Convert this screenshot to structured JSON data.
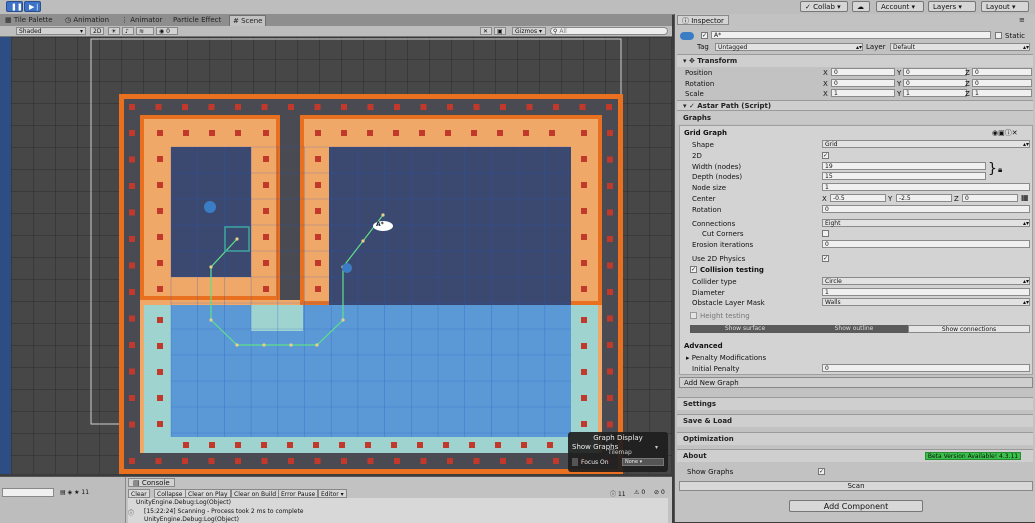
{
  "toolbar": {
    "collab": "Collab",
    "account": "Account",
    "layers": "Layers",
    "layout": "Layout"
  },
  "tabs": [
    "Tile Palette",
    "Animation",
    "Animator",
    "Particle Effect",
    "Scene"
  ],
  "scenebar": {
    "shading": "Shaded",
    "mode2d": "2D",
    "gizmos": "Gizmos",
    "search_placeholder": "All",
    "layers_count": "0"
  },
  "scene": {
    "graph_label": "A*"
  },
  "overlay": {
    "title": "Graph Display",
    "show_graphs": "Show Graphs",
    "tilemap": "Tilemap",
    "focus_on": "Focus On",
    "focus_value": "None"
  },
  "console": {
    "tab": "Console",
    "buttons": [
      "Clear",
      "Collapse",
      "Clear on Play",
      "Clear on Build",
      "Error Pause",
      "Editor"
    ],
    "counts": [
      "11",
      "0",
      "0"
    ],
    "left_count": "11",
    "messages": [
      "UnityEngine.Debug:Log(Object)",
      "[15:22:24] Scanning - Process took 2 ms to complete",
      "UnityEngine.Debug:Log(Object)"
    ]
  },
  "inspector": {
    "tab": "Inspector",
    "object_name": "A*",
    "static_label": "Static",
    "tag_label": "Tag",
    "tag_value": "Untagged",
    "layer_label": "Layer",
    "layer_value": "Default",
    "transform": {
      "title": "Transform",
      "rows": [
        {
          "label": "Position",
          "x": "0",
          "y": "0",
          "z": "0"
        },
        {
          "label": "Rotation",
          "x": "0",
          "y": "0",
          "z": "0"
        },
        {
          "label": "Scale",
          "x": "1",
          "y": "1",
          "z": "1"
        }
      ]
    },
    "astar": {
      "title": "Astar Path (Script)",
      "graphs": "Graphs",
      "grid_graph": "Grid Graph",
      "shape_label": "Shape",
      "shape_value": "Grid",
      "twod_label": "2D",
      "width_label": "Width (nodes)",
      "width_value": "19",
      "depth_label": "Depth (nodes)",
      "depth_value": "15",
      "node_size_label": "Node size",
      "node_size_value": "1",
      "center_label": "Center",
      "center_x": "-0.5",
      "center_y": "-2.5",
      "center_z": "0",
      "rotation_label": "Rotation",
      "rotation_value": "0",
      "connections_label": "Connections",
      "connections_value": "Eight",
      "cut_corners_label": "Cut Corners",
      "erosion_label": "Erosion iterations",
      "erosion_value": "0",
      "use2d_label": "Use 2D Physics",
      "collision_label": "Collision testing",
      "collider_type_label": "Collider type",
      "collider_type_value": "Circle",
      "diameter_label": "Diameter",
      "diameter_value": "1",
      "obstacle_label": "Obstacle Layer Mask",
      "obstacle_value": "Walls",
      "height_label": "Height testing",
      "show_surface": "Show surface",
      "show_outline": "Show outline",
      "show_connections": "Show connections",
      "advanced": "Advanced",
      "penalty_mods": "Penalty Modifications",
      "initial_penalty_label": "Initial Penalty",
      "initial_penalty_value": "0",
      "add_new_graph": "Add New Graph",
      "settings": "Settings",
      "save_load": "Save & Load",
      "optimization": "Optimization",
      "about": "About",
      "beta": "Beta Version Available! 4.3.11",
      "show_graphs": "Show Graphs",
      "scan": "Scan"
    },
    "add_component": "Add Component"
  },
  "colors": {
    "orange_border": "#e8701f",
    "light_orange": "#f0a868",
    "blue_grid": "#5b98d6",
    "teal": "#9fd3cf",
    "tile_red": "#c0392b",
    "path_green": "#5de08a",
    "beta_green": "#39c24a"
  }
}
